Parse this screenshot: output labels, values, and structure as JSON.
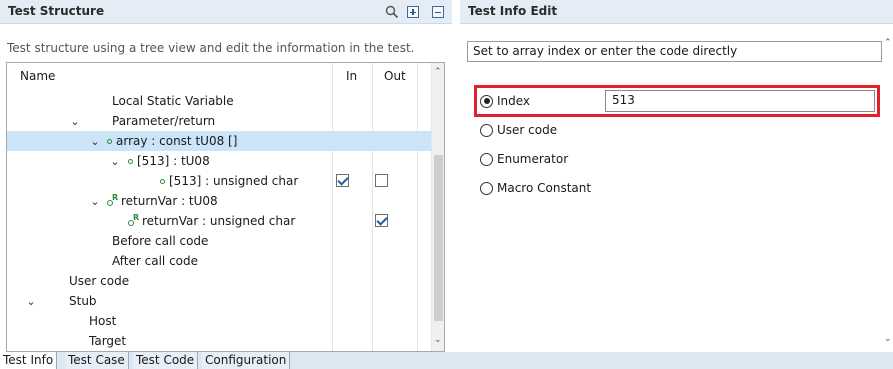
{
  "left": {
    "title": "Test Structure",
    "description": "Test structure using a tree view and edit the information in the test.",
    "columns": {
      "name": "Name",
      "in": "In",
      "out": "Out"
    },
    "rows": [
      {
        "text": "Local Static Variable"
      },
      {
        "text": "Parameter/return"
      },
      {
        "text": "array : const tU08 []"
      },
      {
        "text": "[513] : tU08"
      },
      {
        "text": "[513] : unsigned char"
      },
      {
        "text": "returnVar : tU08"
      },
      {
        "text": "returnVar : unsigned char"
      },
      {
        "text": "Before call code"
      },
      {
        "text": "After call code"
      },
      {
        "text": "User code"
      },
      {
        "text": "Stub"
      },
      {
        "text": "Host"
      },
      {
        "text": "Target"
      }
    ]
  },
  "right": {
    "title": "Test Info Edit",
    "description": "Set to array index or enter the code directly",
    "options": [
      {
        "label": "Index",
        "selected": true
      },
      {
        "label": "User code",
        "selected": false
      },
      {
        "label": "Enumerator",
        "selected": false
      },
      {
        "label": "Macro Constant",
        "selected": false
      }
    ],
    "index_value": "513"
  },
  "tabs": [
    "Test Info",
    "Test Case",
    "Test Code",
    "Configuration"
  ],
  "colors": {
    "header_bg": "#e4ecf5",
    "selected_row": "#cce4f7",
    "highlight": "#e21f2a",
    "icon_green": "#2e8b3a"
  },
  "icons": [
    "search-icon",
    "expand-all-icon",
    "collapse-all-icon",
    "chevron-down-icon",
    "variable-icon",
    "return-variable-icon"
  ]
}
